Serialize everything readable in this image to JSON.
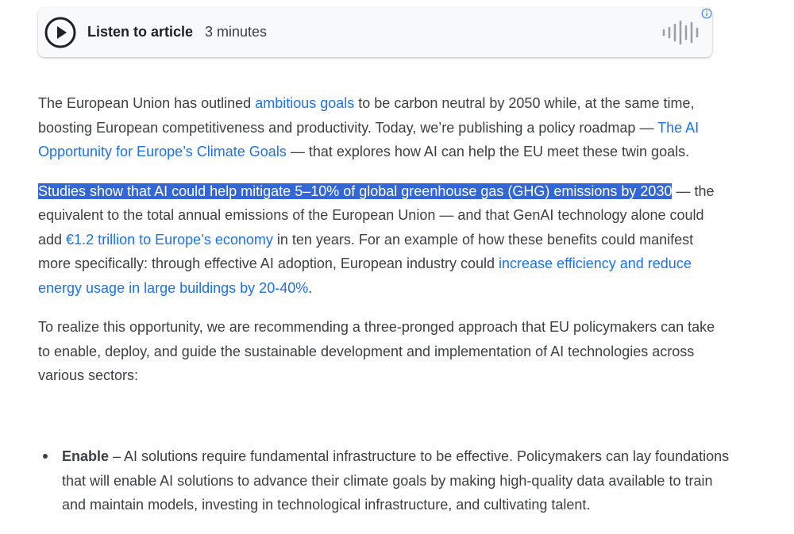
{
  "audio": {
    "listen_label": "Listen to article",
    "duration": "3 minutes",
    "icons": [
      "play-icon",
      "waveform-icon",
      "info-icon"
    ]
  },
  "article": {
    "p1": {
      "t1": "The European Union has outlined ",
      "link1": "ambitious goals",
      "t2": " to be carbon neutral by 2050 while, at the same time, boosting European competitiveness and productivity. Today, we’re publishing a policy roadmap — ",
      "link2": "The AI Opportunity for Europe’s Climate Goals",
      "t3": " — that explores how AI can help the EU meet these twin goals."
    },
    "p2": {
      "highlight": "Studies show that AI could help mitigate 5–10% of global greenhouse gas (GHG) emissions by 2030",
      "t1": " — the equivalent to the total annual emissions of the European Union — and that GenAI technology alone could add ",
      "link1": "€1.2 trillion to Europe’s economy",
      "t2": " in ten years. For an example of how these benefits could manifest more specifically: through effective AI adoption, European industry could ",
      "link2": "increase efficiency and reduce energy usage in large buildings by 20-40%",
      "t3": "."
    },
    "p3": "To realize this opportunity, we are recommending a three-pronged approach that EU policymakers can take to enable, deploy, and guide the sustainable development and implementation of AI technologies across various sectors:",
    "list": [
      {
        "term": "Enable",
        "text": " – AI solutions require fundamental infrastructure to be effective. Policymakers can lay foundations that will enable AI solutions to advance their climate goals by making high-quality data available to train and maintain models, investing in technological infrastructure, and cultivating talent."
      }
    ]
  },
  "colors": {
    "link": "#1a73e8",
    "highlight_bg": "#3367d6",
    "text": "#3c4043"
  }
}
